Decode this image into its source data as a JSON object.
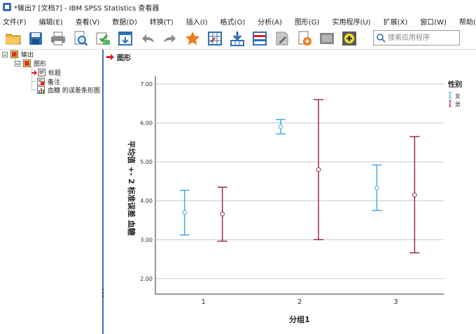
{
  "window": {
    "title": "*输出7 [文档7] - IBM SPSS Statistics 查看器"
  },
  "menu": {
    "items": [
      "文件(F)",
      "编辑(E)",
      "查看(V)",
      "数据(D)",
      "转换(T)",
      "插入(I)",
      "格式(O)",
      "分析(A)",
      "图形(G)",
      "实用程序(U)",
      "扩展(X)",
      "窗口(W)",
      "帮助(H)"
    ]
  },
  "toolbar": {
    "buttons": [
      "open-folder-icon",
      "save-icon",
      "print-icon",
      "print-preview-icon",
      "export-icon",
      "recall-dialog-icon",
      "undo-icon",
      "redo-icon",
      "goto-data-icon",
      "goto-case-icon",
      "goto-variable-icon",
      "variables-icon",
      "designate-window-icon",
      "create-script-icon",
      "run-icon",
      "add-icon"
    ],
    "search_placeholder": "搜索应用程序"
  },
  "outline": {
    "root": "输出",
    "graph": "图形",
    "title": "标题",
    "notes": "备注",
    "chart": "血糖 的误差条形图"
  },
  "content": {
    "section_title": "图形"
  },
  "colors": {
    "female": "#3fb0e6",
    "male": "#a0285a",
    "accent": "#3a6fc4",
    "arrow": "#e02020"
  },
  "chart_data": {
    "type": "errorbar",
    "xlabel": "分组1",
    "ylabel": "平均值 +- 2 标准误差 血糖",
    "legend_title": "性别",
    "legend_position": "top-right",
    "categories": [
      "1",
      "2",
      "3"
    ],
    "ylim": [
      1.6,
      7.2
    ],
    "yticks": [
      "2.00",
      "3.00",
      "4.00",
      "5.00",
      "6.00",
      "7.00"
    ],
    "grid": true,
    "series": [
      {
        "name": "女",
        "mean": [
          3.7,
          5.9,
          4.33
        ],
        "lower": [
          3.12,
          5.72,
          3.75
        ],
        "upper": [
          4.27,
          6.09,
          4.92
        ]
      },
      {
        "name": "男",
        "mean": [
          3.66,
          4.8,
          4.15
        ],
        "lower": [
          2.96,
          3.0,
          2.66
        ],
        "upper": [
          4.35,
          6.6,
          5.65
        ]
      }
    ]
  }
}
